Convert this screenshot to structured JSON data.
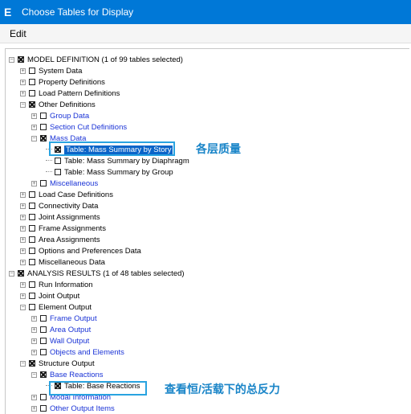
{
  "window": {
    "title": "Choose Tables for Display",
    "icon": "E"
  },
  "menu": {
    "edit": "Edit"
  },
  "annotations": {
    "mass": "各层质量",
    "reactions": "查看恒/活载下的总反力"
  },
  "tree": [
    {
      "label": "MODEL DEFINITION  (1 of 99 tables selected)",
      "checked": true,
      "expander": "minus",
      "blue": false
    },
    {
      "label": "System Data",
      "checked": false,
      "expander": "plus",
      "blue": false
    },
    {
      "label": "Property Definitions",
      "checked": false,
      "expander": "plus",
      "blue": false
    },
    {
      "label": "Load Pattern Definitions",
      "checked": false,
      "expander": "plus",
      "blue": false
    },
    {
      "label": "Other Definitions",
      "checked": true,
      "expander": "minus",
      "blue": false
    },
    {
      "label": "Group Data",
      "checked": false,
      "expander": "plus",
      "blue": true
    },
    {
      "label": "Section Cut Definitions",
      "checked": false,
      "expander": "plus",
      "blue": true
    },
    {
      "label": "Mass Data",
      "checked": true,
      "expander": "minus",
      "blue": true
    },
    {
      "label": "Table:  Mass Summary by Story",
      "checked": true,
      "expander": "leaf",
      "blue": false,
      "selected": true
    },
    {
      "label": "Table:  Mass Summary by Diaphragm",
      "checked": false,
      "expander": "leaf",
      "blue": false
    },
    {
      "label": "Table:  Mass Summary by Group",
      "checked": false,
      "expander": "leaf",
      "blue": false
    },
    {
      "label": "Miscellaneous",
      "checked": false,
      "expander": "plus",
      "blue": true
    },
    {
      "label": "Load Case Definitions",
      "checked": false,
      "expander": "plus",
      "blue": false
    },
    {
      "label": "Connectivity Data",
      "checked": false,
      "expander": "plus",
      "blue": false
    },
    {
      "label": "Joint Assignments",
      "checked": false,
      "expander": "plus",
      "blue": false
    },
    {
      "label": "Frame Assignments",
      "checked": false,
      "expander": "plus",
      "blue": false
    },
    {
      "label": "Area Assignments",
      "checked": false,
      "expander": "plus",
      "blue": false
    },
    {
      "label": "Options and Preferences Data",
      "checked": false,
      "expander": "plus",
      "blue": false
    },
    {
      "label": "Miscellaneous Data",
      "checked": false,
      "expander": "plus",
      "blue": false
    },
    {
      "label": "ANALYSIS RESULTS  (1 of 48 tables selected)",
      "checked": true,
      "expander": "minus",
      "blue": false
    },
    {
      "label": "Run Information",
      "checked": false,
      "expander": "plus",
      "blue": false
    },
    {
      "label": "Joint Output",
      "checked": false,
      "expander": "plus",
      "blue": false
    },
    {
      "label": "Element Output",
      "checked": false,
      "expander": "minus",
      "blue": false
    },
    {
      "label": "Frame Output",
      "checked": false,
      "expander": "plus",
      "blue": true
    },
    {
      "label": "Area Output",
      "checked": false,
      "expander": "plus",
      "blue": true
    },
    {
      "label": "Wall Output",
      "checked": false,
      "expander": "plus",
      "blue": true
    },
    {
      "label": "Objects and Elements",
      "checked": false,
      "expander": "plus",
      "blue": true
    },
    {
      "label": "Structure Output",
      "checked": true,
      "expander": "minus",
      "blue": false
    },
    {
      "label": "Base Reactions",
      "checked": true,
      "expander": "minus",
      "blue": true
    },
    {
      "label": "Table:  Base Reactions",
      "checked": true,
      "expander": "leaf",
      "blue": false
    },
    {
      "label": "Modal Information",
      "checked": false,
      "expander": "plus",
      "blue": true
    },
    {
      "label": "Other Output Items",
      "checked": false,
      "expander": "plus",
      "blue": true
    }
  ]
}
